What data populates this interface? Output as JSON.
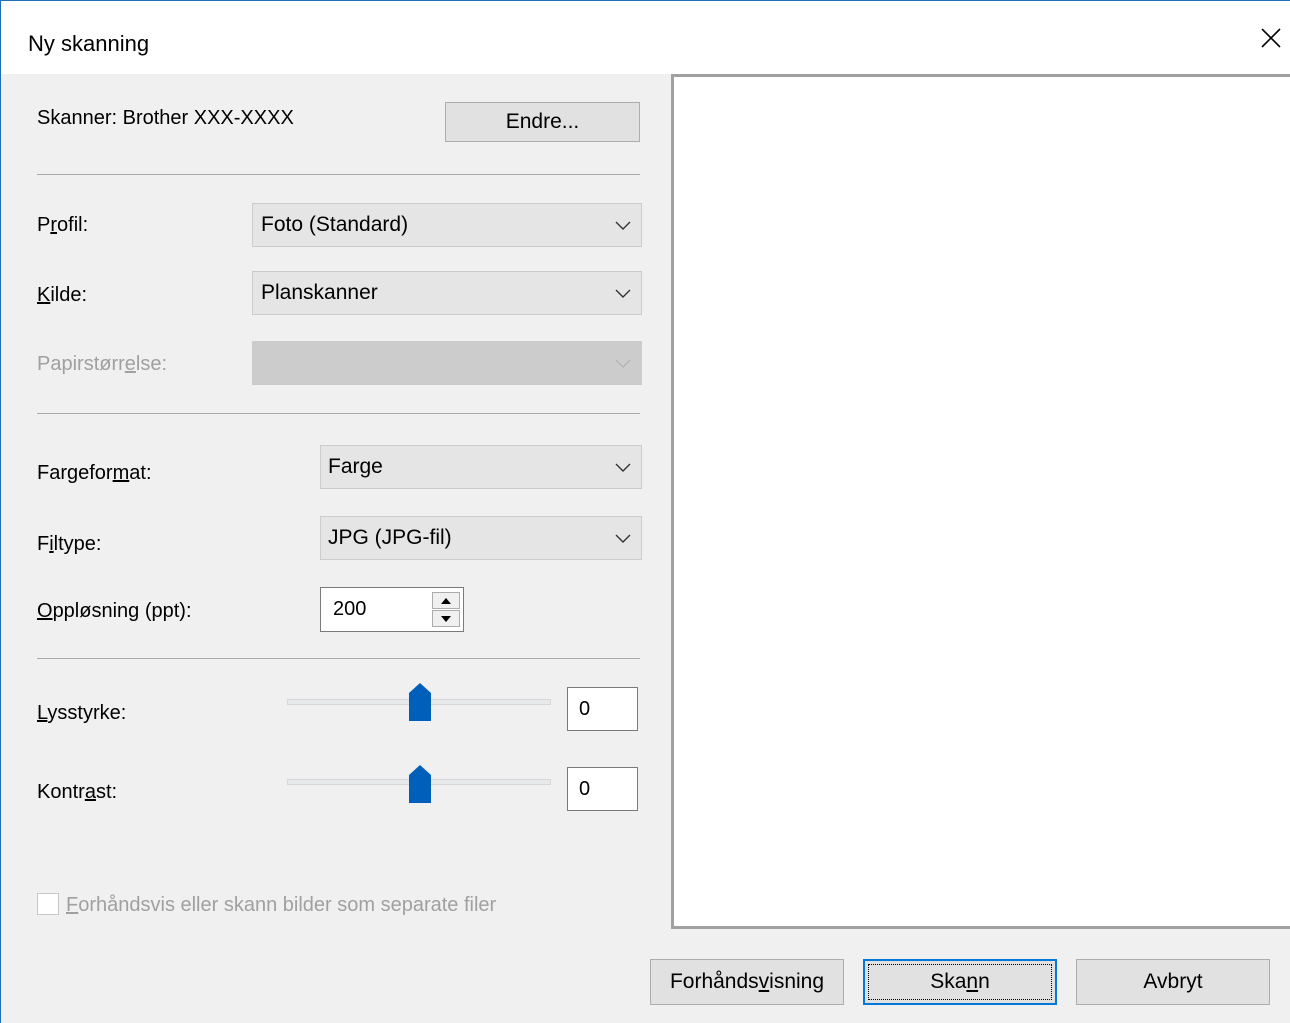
{
  "window": {
    "title": "Ny skanning"
  },
  "scanner": {
    "label": "Skanner: Brother XXX-XXXX",
    "change_button": "Endre..."
  },
  "fields": {
    "profile": {
      "label_pre": "P",
      "label_u": "r",
      "label_post": "ofil:",
      "value": "Foto (Standard)"
    },
    "source": {
      "label_pre": "",
      "label_u": "K",
      "label_post": "ilde:",
      "value": "Planskanner"
    },
    "paper_size": {
      "label_pre": "Papirstørr",
      "label_u": "e",
      "label_post": "lse:",
      "value": ""
    },
    "color_format": {
      "label_pre": "Fargefor",
      "label_u": "m",
      "label_post": "at:",
      "value": "Farge"
    },
    "file_type": {
      "label_pre": "F",
      "label_u": "i",
      "label_post": "ltype:",
      "value": "JPG (JPG-fil)"
    },
    "resolution": {
      "label_pre": "",
      "label_u": "O",
      "label_post": "ppløsning (ppt):",
      "value": "200"
    }
  },
  "sliders": {
    "brightness": {
      "label_pre": "",
      "label_u": "L",
      "label_post": "ysstyrke:",
      "value": "0"
    },
    "contrast": {
      "label_pre": "Kontr",
      "label_u": "a",
      "label_post": "st:",
      "value": "0"
    }
  },
  "separate_files": {
    "label_pre": "",
    "label_u": "F",
    "label_post": "orhåndsvis eller skann bilder som separate filer",
    "checked": false
  },
  "buttons": {
    "preview": {
      "pre": "Forhånds",
      "u": "v",
      "post": "isning"
    },
    "scan": {
      "pre": "Ska",
      "u": "n",
      "post": "n"
    },
    "cancel": "Avbryt"
  },
  "colors": {
    "accent": "#0078d7",
    "slider_thumb": "#005fb8",
    "disabled_text": "#a0a0a0"
  },
  "icons": {
    "close": "close-icon",
    "dropdown": "chevron-down-icon",
    "spin_up": "spin-up-icon",
    "spin_down": "spin-down-icon"
  }
}
